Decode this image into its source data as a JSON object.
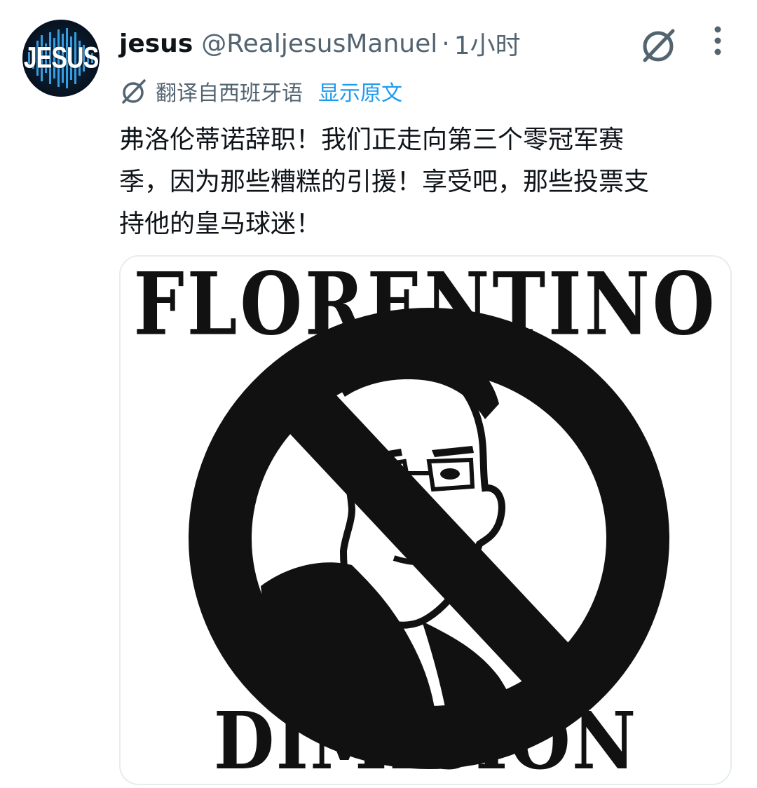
{
  "avatar": {
    "label": "JESUS"
  },
  "author": {
    "display_name": "jesus",
    "handle": "@RealjesusManuel",
    "separator": "·",
    "time": "1小时"
  },
  "icons": {
    "grok": "grok-icon",
    "more": "more-vertical-icon",
    "translate": "translate-icon"
  },
  "translation": {
    "label": "翻译自西班牙语",
    "show_original": "显示原文"
  },
  "tweet": {
    "text": "弗洛伦蒂诺辞职！我们正走向第三个零冠军赛\n季，因为那些糟糕的引援！享受吧，那些投票支\n持他的皇马球迷！"
  },
  "media": {
    "top_text": "FLORENTINO",
    "bottom_text": "DIMISIÓN"
  },
  "colors": {
    "link": "#1d9bf0",
    "secondary_text": "#536471",
    "primary_text": "#0f1419",
    "avatar_bg": "#07121f",
    "poster_ink": "#111111"
  }
}
